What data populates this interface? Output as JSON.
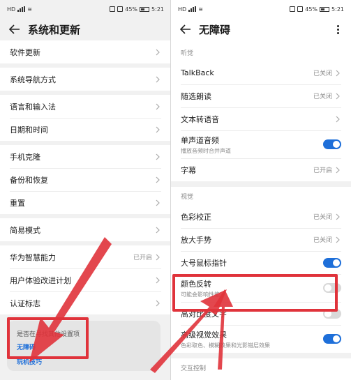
{
  "left": {
    "status": {
      "carrier": "HD",
      "battery": "45%",
      "time": "5:21"
    },
    "title": "系统和更新",
    "items": [
      {
        "label": "软件更新",
        "value": ""
      },
      {
        "label": "系统导航方式",
        "value": ""
      },
      {
        "label": "语言和输入法",
        "value": ""
      },
      {
        "label": "日期和时间",
        "value": ""
      },
      {
        "label": "手机克隆",
        "value": ""
      },
      {
        "label": "备份和恢复",
        "value": ""
      },
      {
        "label": "重置",
        "value": ""
      },
      {
        "label": "简易模式",
        "value": ""
      },
      {
        "label": "华为智慧能力",
        "value": "已开启"
      },
      {
        "label": "用户体验改进计划",
        "value": ""
      },
      {
        "label": "认证标志",
        "value": ""
      }
    ],
    "search_card": {
      "question": "是否在寻找其他设置项",
      "link1": "无障碍",
      "link2": "玩机技巧"
    }
  },
  "right": {
    "status": {
      "carrier": "HD",
      "battery": "45%",
      "time": "5:21"
    },
    "title": "无障碍",
    "sections": {
      "hearing": "听觉",
      "vision": "视觉",
      "interaction": "交互控制"
    },
    "hearing_items": [
      {
        "label": "TalkBack",
        "value": "已关闭"
      },
      {
        "label": "随选朗读",
        "value": "已关闭"
      },
      {
        "label": "文本转语音",
        "value": ""
      },
      {
        "label": "单声道音频",
        "sub": "播放音频时合并声道",
        "toggle": "on"
      },
      {
        "label": "字幕",
        "value": "已开启"
      }
    ],
    "vision_items": [
      {
        "label": "色彩校正",
        "value": "已关闭"
      },
      {
        "label": "放大手势",
        "value": "已关闭"
      },
      {
        "label": "大号鼠标指针",
        "toggle": "on"
      },
      {
        "label": "颜色反转",
        "sub": "可能会影响性能",
        "toggle": "off"
      },
      {
        "label": "高对比度文字",
        "toggle": "off"
      },
      {
        "label": "高级视觉效果",
        "sub": "色彩取色、模糊效果和光影错层效果",
        "toggle": "on"
      }
    ]
  },
  "colors": {
    "accent": "#1e6fd9",
    "highlight": "#e0333b"
  }
}
